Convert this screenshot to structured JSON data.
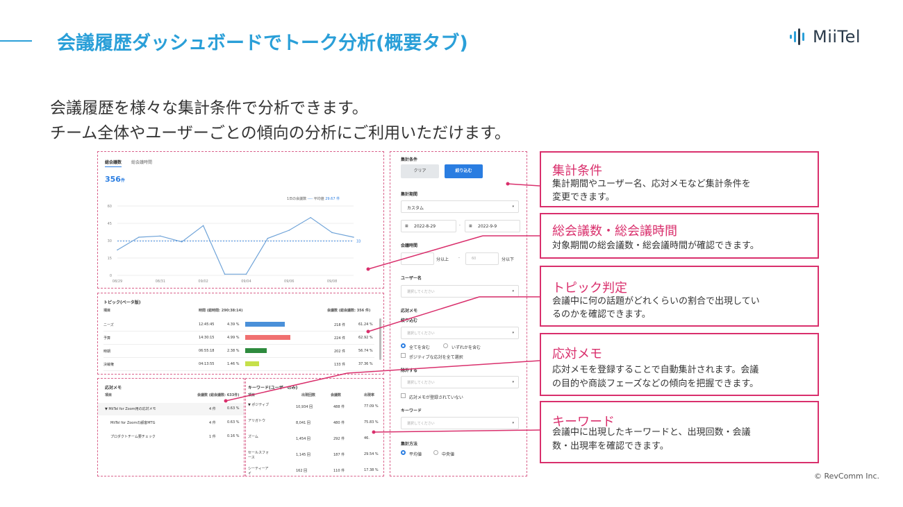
{
  "header": {
    "title": "会議履歴ダッシュボードでトーク分析(概要タブ)",
    "logo_text": "MiiTel"
  },
  "subtitle": {
    "line1": "会議履歴を様々な集計条件で分析できます。",
    "line2": "チーム全体やユーザーごとの傾向の分析にご利用いただけます。"
  },
  "chart_panel": {
    "tab_count": "総会議数",
    "tab_time": "総会議時間",
    "total": "356",
    "total_unit": "件",
    "legend_daily": "1日の会議数",
    "legend_avg": "平均値",
    "legend_avg_value": "29.67 件",
    "avg_label": "33"
  },
  "chart_data": {
    "type": "line",
    "x": [
      "08/29",
      "08/30",
      "08/31",
      "09/01",
      "09/02",
      "09/03",
      "09/04",
      "09/05",
      "09/06",
      "09/07",
      "09/08",
      "09/09"
    ],
    "x_tick_labels": [
      "08/29",
      "08/31",
      "09/02",
      "09/04",
      "09/06",
      "09/08"
    ],
    "series": [
      {
        "values": [
          22,
          33,
          34,
          29,
          43,
          1,
          1,
          32,
          39,
          50,
          37,
          33
        ]
      }
    ],
    "average": 29.67,
    "y_ticks": [
      0,
      15,
      30,
      45,
      60
    ],
    "ylim": [
      0,
      60
    ]
  },
  "topic_panel": {
    "title": "トピック(ベータ版)",
    "col_item": "項目",
    "col_time": "時間 (総時間: 290:38:14)",
    "col_count": "会議数 (総会議数: 356 件)",
    "rows": [
      {
        "name": "ニーズ",
        "time": "12:45:45",
        "pct": "4.39 %",
        "count": "218 件",
        "rate": "61.24 %",
        "bar": 0.44,
        "color": "#4a90d9"
      },
      {
        "name": "予算",
        "time": "14:30:15",
        "pct": "4.99 %",
        "count": "224 件",
        "rate": "62.92 %",
        "bar": 0.5,
        "color": "#f07070"
      },
      {
        "name": "時期",
        "time": "06:55:18",
        "pct": "2.38 %",
        "count": "202 件",
        "rate": "56.74 %",
        "bar": 0.24,
        "color": "#2e8b3e"
      },
      {
        "name": "決裁権",
        "time": "04:13:55",
        "pct": "1.46 %",
        "count": "133 件",
        "rate": "37.36 %",
        "bar": 0.15,
        "color": "#c6e04a"
      }
    ]
  },
  "memo_panel": {
    "title": "応対メモ",
    "col_item": "項目",
    "col_count": "会議数 (総会議数: 633件)",
    "rows": [
      {
        "name": "▼ MiiTel for Zoom用の応対メモ",
        "count": "4 件",
        "pct": "0.63 %"
      },
      {
        "name": "MiiTel for Zoomの顧客MTG",
        "count": "4 件",
        "pct": "0.63 %"
      },
      {
        "name": "プロダクトチーム要チェック",
        "count": "1 件",
        "pct": "0.16 %"
      }
    ]
  },
  "keyword_panel": {
    "title": "キーワード(ユーザーのみ)",
    "col_item": "項目",
    "col_times": "出現回数",
    "col_count": "会議数",
    "col_rate": "出現率",
    "rows": [
      {
        "name": "▼ ポジティブ",
        "times": "10,934 回",
        "count": "488 件",
        "rate": "77.09 %"
      },
      {
        "name": "アリガトウ",
        "times": "8,041 回",
        "count": "480 件",
        "rate": "75.83 %"
      },
      {
        "name": "ズーム",
        "times": "1,454 回",
        "count": "292 件",
        "rate": "46."
      },
      {
        "name": "セールスフォ\nース",
        "times": "1,145 回",
        "count": "187 件",
        "rate": "29.54 %"
      },
      {
        "name": "シーティーア\nイ",
        "times": "162 回",
        "count": "110 件",
        "rate": "17.38 %"
      }
    ]
  },
  "filter_panel": {
    "section_conditions": "集計条件",
    "clear_button": "クリア",
    "filter_button": "絞り込む",
    "section_period": "集計期間",
    "period_value": "カスタム",
    "date_from": "2022-8-29",
    "date_sep": "-",
    "date_to": "2022-9-9",
    "section_duration": "会議時間",
    "duration_over": "分以上",
    "duration_sep": "-",
    "duration_to_placeholder": "60",
    "duration_under": "分以下",
    "section_user": "ユーザー名",
    "select_placeholder": "選択してください",
    "section_memo": "応対メモ",
    "memo_filter": "絞り込む",
    "radio_all": "全てを含む",
    "radio_any": "いずれかを含む",
    "check_positive": "ポジティブな応対を全て選択",
    "memo_exclude": "除外する",
    "check_no_memo": "応対メモが登録されていない",
    "section_keyword": "キーワード",
    "section_method": "集計方法",
    "method_avg": "平均値",
    "method_median": "中央値"
  },
  "callouts": [
    {
      "title": "集計条件",
      "desc1": "集計期間やユーザー名、応対メモなど集計条件を",
      "desc2": "変更できます。"
    },
    {
      "title": "総会議数・総会議時間",
      "desc1": "対象期間の総会議数・総会議時間が確認できます。",
      "desc2": ""
    },
    {
      "title": "トピック判定",
      "desc1": "会議中に何の話題がどれくらいの割合で出現してい",
      "desc2": "るのかを確認できます。"
    },
    {
      "title": "応対メモ",
      "desc1": "応対メモを登録することで自動集計されます。会議",
      "desc2": "の目的や商談フェーズなどの傾向を把握できます。"
    },
    {
      "title": "キーワード",
      "desc1": "会議中に出現したキーワードと、出現回数・会議",
      "desc2": "数・出現率を確認できます。"
    }
  ],
  "colors": {
    "accent": "#2a9fd8",
    "callout": "#d92f6c",
    "primary_button": "#2a7de1"
  },
  "copyright": "© RevComm Inc."
}
